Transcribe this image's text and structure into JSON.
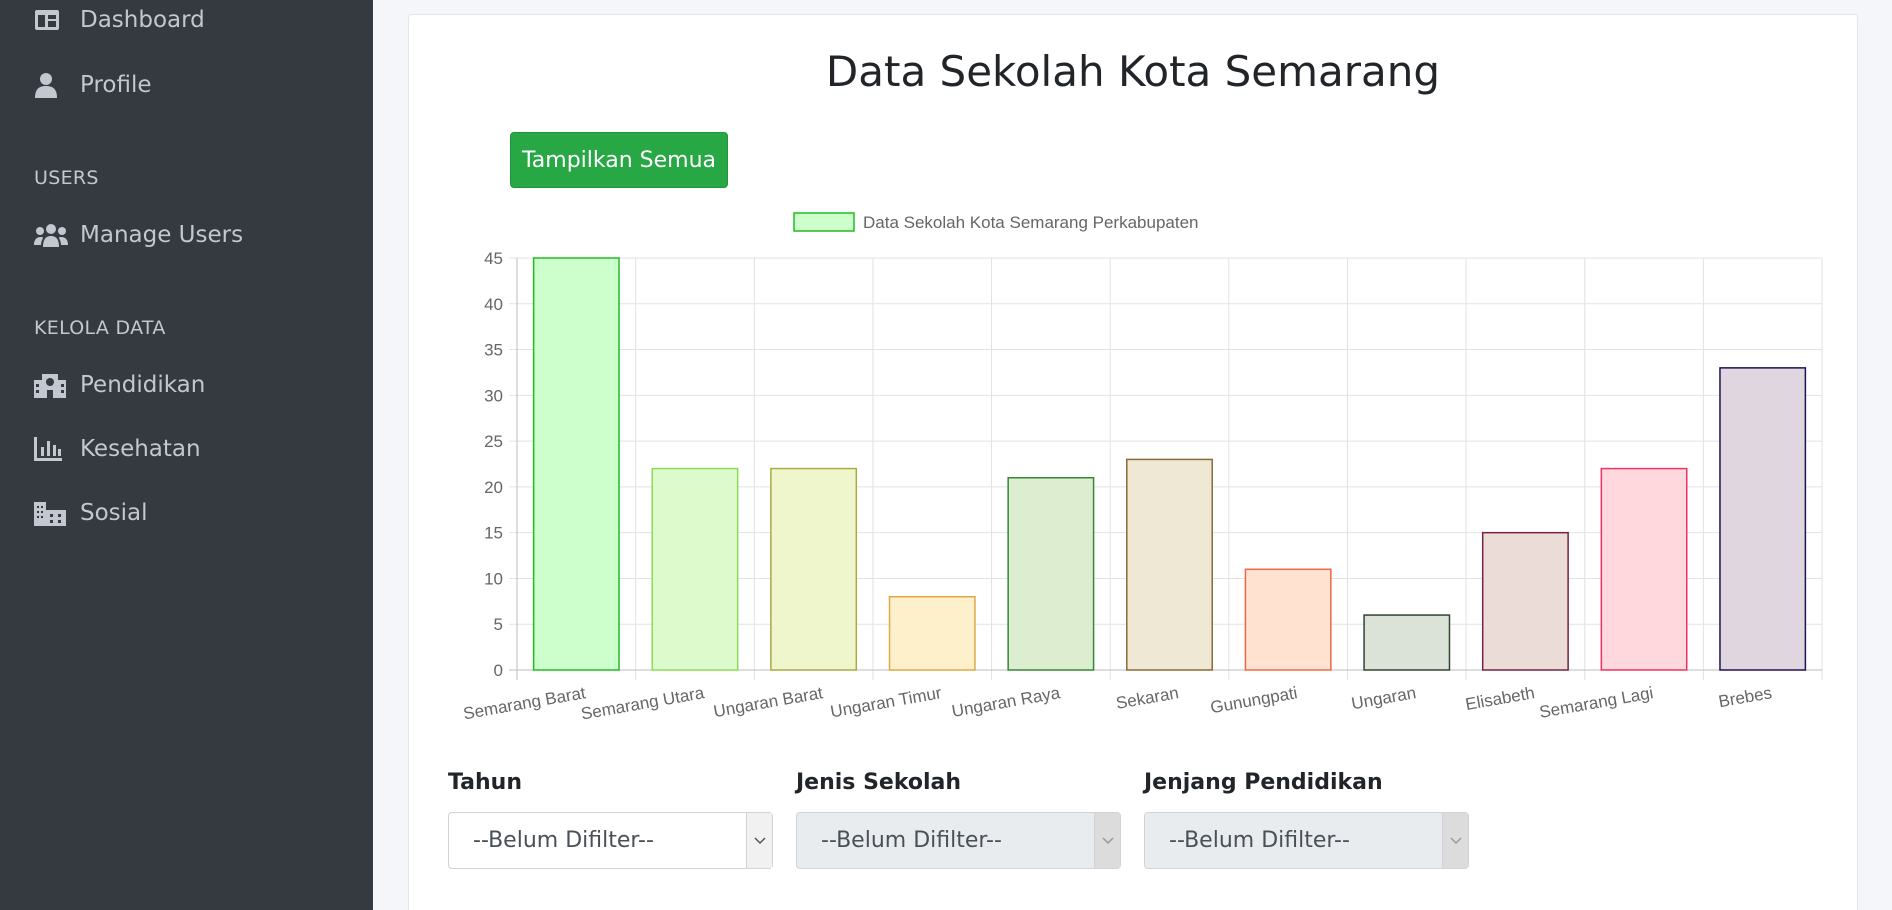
{
  "sidebar": {
    "items_top": [
      {
        "label": "Dashboard",
        "icon": "dashboard-icon"
      },
      {
        "label": "Profile",
        "icon": "user-icon"
      }
    ],
    "section_users": "USERS",
    "manage_users": {
      "label": "Manage Users",
      "icon": "users-icon"
    },
    "section_kelola": "KELOLA DATA",
    "kelola_items": [
      {
        "label": "Pendidikan",
        "icon": "school-icon"
      },
      {
        "label": "Kesehatan",
        "icon": "chart-bar-icon"
      },
      {
        "label": "Sosial",
        "icon": "building-icon"
      }
    ]
  },
  "main": {
    "title": "Data Sekolah Kota Semarang",
    "show_all_button": "Tampilkan Semua"
  },
  "chart_data": {
    "type": "bar",
    "legend": "Data Sekolah Kota Semarang Perkabupaten",
    "legend_position": "top",
    "categories": [
      "Semarang Barat",
      "Semarang Utara",
      "Ungaran Barat",
      "Ungaran Timur",
      "Ungaran Raya",
      "Sekaran",
      "Gunungpati",
      "Ungaran",
      "Elisabeth",
      "Semarang Lagi",
      "Brebes"
    ],
    "values": [
      45,
      22,
      22,
      8,
      21,
      23,
      11,
      6,
      15,
      22,
      33
    ],
    "ylim": [
      0,
      45
    ],
    "yticks": [
      0,
      5,
      10,
      15,
      20,
      25,
      30,
      35,
      40,
      45
    ],
    "grid": true,
    "fill_colors": [
      "#ccffcc",
      "#ddfacc",
      "#f0f6cc",
      "#fff0cc",
      "#ddedd0",
      "#efe8d4",
      "#ffe3d0",
      "#dbe2d8",
      "#ecdcd8",
      "#ffd8de",
      "#e0d6e0"
    ],
    "border_colors": [
      "#22bb22",
      "#88dd55",
      "#aaaa44",
      "#ddaa44",
      "#338833",
      "#8a6a33",
      "#ee6644",
      "#334433",
      "#772244",
      "#ee3366",
      "#221155"
    ]
  },
  "filters": [
    {
      "label": "Tahun",
      "value": "--Belum Difilter--",
      "disabled": false
    },
    {
      "label": "Jenis Sekolah",
      "value": "--Belum Difilter--",
      "disabled": true
    },
    {
      "label": "Jenjang Pendidikan",
      "value": "--Belum Difilter--",
      "disabled": true
    }
  ]
}
